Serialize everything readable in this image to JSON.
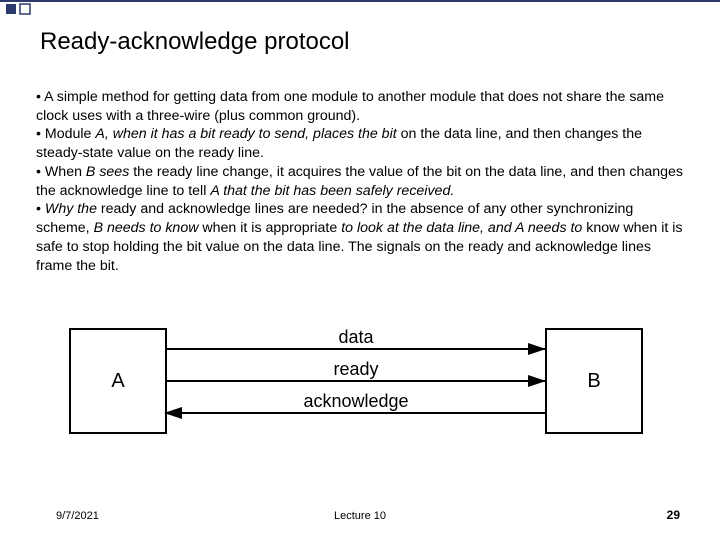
{
  "title": "Ready-acknowledge protocol",
  "bullets": {
    "b1_prefix": "•  A simple method for getting data from one module to another module that does not share the same clock uses with a three-wire (plus common ground).",
    "b2_prefix": "•  Module ",
    "b2_ital1": "A, when it has a bit ready to send, places the bit",
    "b2_mid": " on the data line, and then changes the steady-state value on the ready line.",
    "b3_prefix": "•  When ",
    "b3_ital1": "B sees",
    "b3_mid1": " the ready line change, it acquires the value of the bit on the data line, and then changes the acknowledge line to tell ",
    "b3_ital2": "A that the bit has been safely received.",
    "b4_prefix": "• ",
    "b4_ital1": "Why the",
    "b4_mid1": " ready and acknowledge lines are needed? in the absence of any other synchronizing scheme, ",
    "b4_ital2": "B needs to know",
    "b4_mid2": " when it is appropriate ",
    "b4_ital3": "to look at the data line, and A needs to",
    "b4_mid3": " know when it is safe to stop holding the bit value on the data line. The signals on the ready and acknowledge lines frame the bit."
  },
  "diagram": {
    "box_a": "A",
    "box_b": "B",
    "line_data": "data",
    "line_ready": "ready",
    "line_ack": "acknowledge"
  },
  "footer": {
    "date": "9/7/2021",
    "center": "Lecture 10",
    "page": "29"
  }
}
